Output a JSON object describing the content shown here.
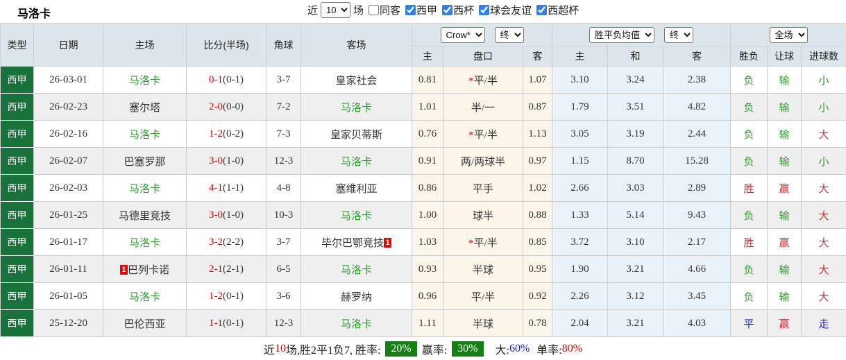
{
  "title": "马洛卡",
  "topbar": {
    "recent_label": "近",
    "recent_value": "10",
    "games_label": "场",
    "checkboxes": [
      {
        "label": "同客",
        "checked": false
      },
      {
        "label": "西甲",
        "checked": true
      },
      {
        "label": "西杯",
        "checked": true
      },
      {
        "label": "球会友谊",
        "checked": true
      },
      {
        "label": "西超杯",
        "checked": true
      }
    ]
  },
  "header": {
    "left_columns": [
      "类型",
      "日期",
      "主场",
      "比分(半场)",
      "角球",
      "客场"
    ],
    "odds_company_select": "Crow*",
    "odds_state_select": "终",
    "mean_select": "胜平负均值",
    "mean_state_select": "终",
    "scope_select": "全场",
    "sub_columns": [
      "主",
      "盘口",
      "客",
      "主",
      "和",
      "客",
      "胜负",
      "让球",
      "进球数"
    ]
  },
  "rows": [
    {
      "league": "西甲",
      "date": "26-03-01",
      "home": "马洛卡",
      "home_color": "green",
      "home_red_card": "",
      "score": "0-1",
      "half_score": "(0-1)",
      "corners": "3-7",
      "away": "皇家社会",
      "away_color": "dark",
      "away_red_card": "",
      "odds_home": "0.81",
      "handicap_star": "*",
      "handicap": "平/半",
      "odds_away": "1.07",
      "mean_home": "3.10",
      "mean_draw": "3.24",
      "mean_away": "2.38",
      "result": "负",
      "result_color": "green",
      "handicap_result": "输",
      "handicap_result_color": "green",
      "goals": "小",
      "goals_color": "green"
    },
    {
      "league": "西甲",
      "date": "26-02-23",
      "home": "塞尔塔",
      "home_color": "dark",
      "home_red_card": "",
      "score": "2-0",
      "half_score": "(0-0)",
      "corners": "7-2",
      "away": "马洛卡",
      "away_color": "green",
      "away_red_card": "",
      "odds_home": "1.01",
      "handicap_star": "",
      "handicap": "半/一",
      "odds_away": "0.87",
      "mean_home": "1.79",
      "mean_draw": "3.51",
      "mean_away": "4.82",
      "result": "负",
      "result_color": "green",
      "handicap_result": "输",
      "handicap_result_color": "green",
      "goals": "小",
      "goals_color": "green"
    },
    {
      "league": "西甲",
      "date": "26-02-16",
      "home": "马洛卡",
      "home_color": "green",
      "home_red_card": "",
      "score": "1-2",
      "half_score": "(0-2)",
      "corners": "7-3",
      "away": "皇家贝蒂斯",
      "away_color": "dark",
      "away_red_card": "",
      "odds_home": "0.76",
      "handicap_star": "*",
      "handicap": "平/半",
      "odds_away": "1.13",
      "mean_home": "3.05",
      "mean_draw": "3.19",
      "mean_away": "2.44",
      "result": "负",
      "result_color": "green",
      "handicap_result": "输",
      "handicap_result_color": "green",
      "goals": "大",
      "goals_color": "red"
    },
    {
      "league": "西甲",
      "date": "26-02-07",
      "home": "巴塞罗那",
      "home_color": "dark",
      "home_red_card": "",
      "score": "3-0",
      "half_score": "(1-0)",
      "corners": "12-3",
      "away": "马洛卡",
      "away_color": "green",
      "away_red_card": "",
      "odds_home": "0.91",
      "handicap_star": "",
      "handicap": "两/两球半",
      "odds_away": "0.97",
      "mean_home": "1.15",
      "mean_draw": "8.70",
      "mean_away": "15.28",
      "result": "负",
      "result_color": "green",
      "handicap_result": "输",
      "handicap_result_color": "green",
      "goals": "小",
      "goals_color": "green"
    },
    {
      "league": "西甲",
      "date": "26-02-03",
      "home": "马洛卡",
      "home_color": "green",
      "home_red_card": "",
      "score": "4-1",
      "half_score": "(1-1)",
      "corners": "4-8",
      "away": "塞维利亚",
      "away_color": "dark",
      "away_red_card": "",
      "odds_home": "0.86",
      "handicap_star": "",
      "handicap": "平手",
      "odds_away": "1.02",
      "mean_home": "2.66",
      "mean_draw": "3.03",
      "mean_away": "2.89",
      "result": "胜",
      "result_color": "red",
      "handicap_result": "赢",
      "handicap_result_color": "red",
      "goals": "大",
      "goals_color": "red"
    },
    {
      "league": "西甲",
      "date": "26-01-25",
      "home": "马德里竞技",
      "home_color": "dark",
      "home_red_card": "",
      "score": "3-0",
      "half_score": "(1-0)",
      "corners": "10-3",
      "away": "马洛卡",
      "away_color": "green",
      "away_red_card": "",
      "odds_home": "1.00",
      "handicap_star": "",
      "handicap": "球半",
      "odds_away": "0.88",
      "mean_home": "1.33",
      "mean_draw": "5.14",
      "mean_away": "9.43",
      "result": "负",
      "result_color": "green",
      "handicap_result": "输",
      "handicap_result_color": "green",
      "goals": "大",
      "goals_color": "red"
    },
    {
      "league": "西甲",
      "date": "26-01-17",
      "home": "马洛卡",
      "home_color": "green",
      "home_red_card": "",
      "score": "3-2",
      "half_score": "(2-2)",
      "corners": "3-7",
      "away": "毕尔巴鄂竞技",
      "away_color": "dark",
      "away_red_card": "1",
      "odds_home": "1.03",
      "handicap_star": "*",
      "handicap": "平/半",
      "odds_away": "0.85",
      "mean_home": "3.72",
      "mean_draw": "3.10",
      "mean_away": "2.17",
      "result": "胜",
      "result_color": "red",
      "handicap_result": "赢",
      "handicap_result_color": "red",
      "goals": "大",
      "goals_color": "red"
    },
    {
      "league": "西甲",
      "date": "26-01-11",
      "home": "巴列卡诺",
      "home_color": "dark",
      "home_red_card": "1",
      "score": "2-1",
      "half_score": "(2-1)",
      "corners": "6-5",
      "away": "马洛卡",
      "away_color": "green",
      "away_red_card": "",
      "odds_home": "0.93",
      "handicap_star": "",
      "handicap": "半球",
      "odds_away": "0.95",
      "mean_home": "1.90",
      "mean_draw": "3.21",
      "mean_away": "4.66",
      "result": "负",
      "result_color": "green",
      "handicap_result": "输",
      "handicap_result_color": "green",
      "goals": "大",
      "goals_color": "red"
    },
    {
      "league": "西甲",
      "date": "26-01-05",
      "home": "马洛卡",
      "home_color": "green",
      "home_red_card": "",
      "score": "1-2",
      "half_score": "(0-1)",
      "corners": "3-6",
      "away": "赫罗纳",
      "away_color": "dark",
      "away_red_card": "",
      "odds_home": "0.96",
      "handicap_star": "",
      "handicap": "平/半",
      "odds_away": "0.92",
      "mean_home": "2.26",
      "mean_draw": "3.12",
      "mean_away": "3.45",
      "result": "负",
      "result_color": "green",
      "handicap_result": "输",
      "handicap_result_color": "green",
      "goals": "大",
      "goals_color": "red"
    },
    {
      "league": "西甲",
      "date": "25-12-20",
      "home": "巴伦西亚",
      "home_color": "dark",
      "home_red_card": "",
      "score": "1-1",
      "half_score": "(0-1)",
      "corners": "12-3",
      "away": "马洛卡",
      "away_color": "green",
      "away_red_card": "",
      "odds_home": "1.11",
      "handicap_star": "",
      "handicap": "半球",
      "odds_away": "0.78",
      "mean_home": "2.04",
      "mean_draw": "3.21",
      "mean_away": "4.03",
      "result": "平",
      "result_color": "blue",
      "handicap_result": "赢",
      "handicap_result_color": "red",
      "goals": "走",
      "goals_color": "blue"
    }
  ],
  "footer": {
    "prefix": "近",
    "count": "10",
    "summary": "场,胜2平1负7, 胜率:",
    "win_rate": "20%",
    "profit_label": "赢率:",
    "profit_rate": "30%",
    "big_label": "大:",
    "big_rate": "60%",
    "single_label": "单率:",
    "single_rate": "80%"
  },
  "colors": {
    "league_cell_green": "#177339",
    "self_team_green": "#2ba32b",
    "score_red": "#e60000",
    "win_red": "#c83434",
    "lose_green": "#2e9e2e",
    "draw_blue": "#2222cc",
    "footer_badge_green": "#148014",
    "header_bg": "#dce5e9",
    "odds_bg": "#fbf5ea",
    "mean_bg": "#ebf3fa"
  }
}
